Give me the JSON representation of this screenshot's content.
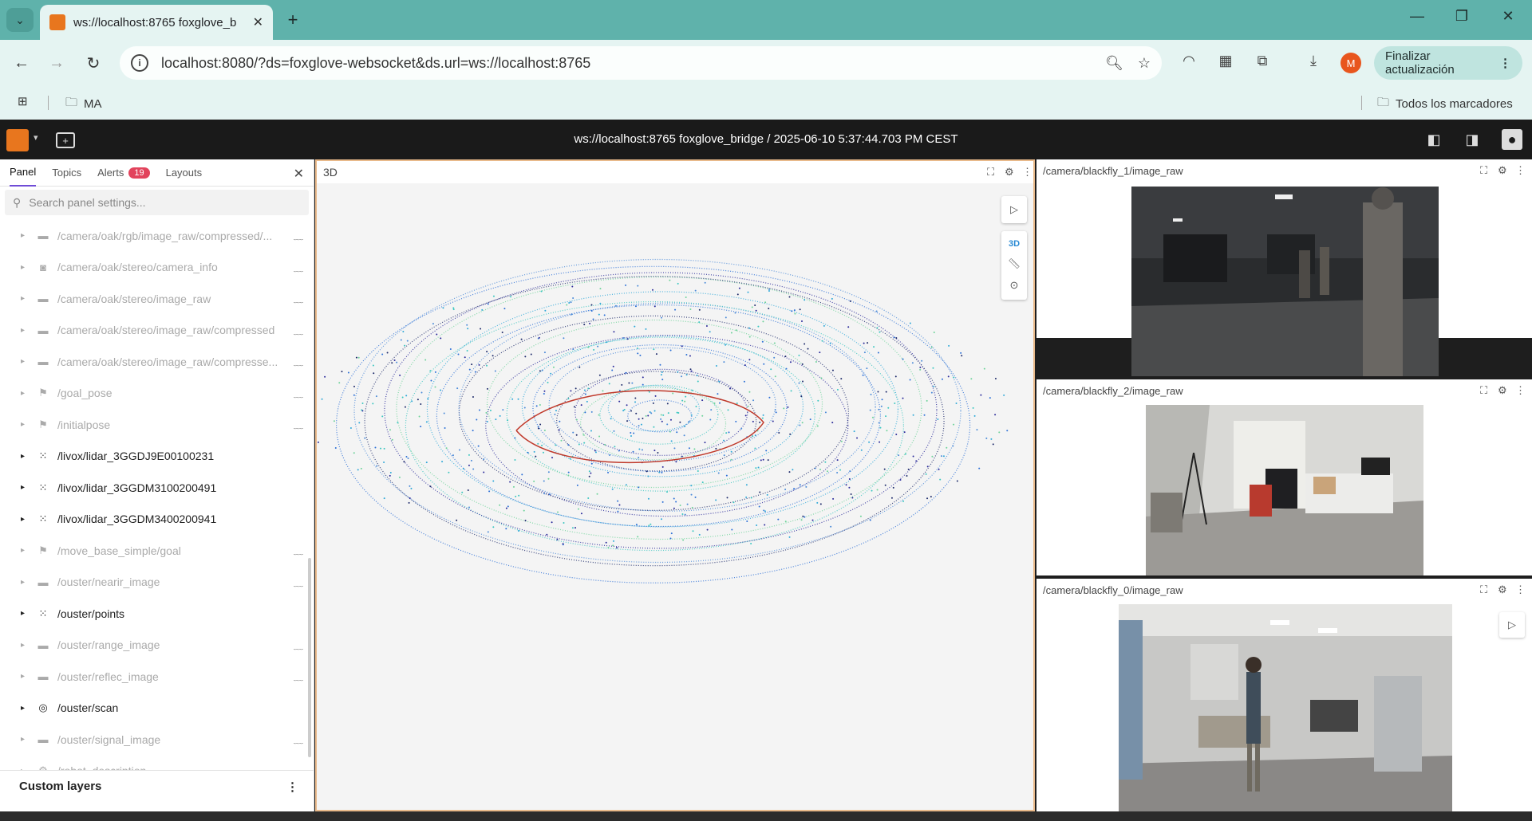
{
  "browser": {
    "tab_title": "ws://localhost:8765 foxglove_b",
    "url": "localhost:8080/?ds=foxglove-websocket&ds.url=ws://localhost:8765",
    "profile_initial": "M",
    "update_label": "Finalizar actualización",
    "bookmark_folder": "MA",
    "all_bookmarks": "Todos los marcadores"
  },
  "app": {
    "title": "ws://localhost:8765 foxglove_bridge / 2025-06-10 5:37:44.703 PM CEST"
  },
  "sidebar": {
    "tabs": [
      "Panel",
      "Topics",
      "Alerts",
      "Layouts"
    ],
    "alerts_count": "19",
    "search_placeholder": "Search panel settings...",
    "items": [
      {
        "label": "/camera/oak/rgb/image_raw/compressed/...",
        "icon": "image-icon",
        "dim": true
      },
      {
        "label": "/camera/oak/stereo/camera_info",
        "icon": "camera-icon",
        "dim": true
      },
      {
        "label": "/camera/oak/stereo/image_raw",
        "icon": "image-icon",
        "dim": true
      },
      {
        "label": "/camera/oak/stereo/image_raw/compressed",
        "icon": "image-icon",
        "dim": true
      },
      {
        "label": "/camera/oak/stereo/image_raw/compresse...",
        "icon": "image-icon",
        "dim": true
      },
      {
        "label": "/goal_pose",
        "icon": "flag-icon",
        "dim": true
      },
      {
        "label": "/initialpose",
        "icon": "flag-icon",
        "dim": true
      },
      {
        "label": "/livox/lidar_3GGDJ9E00100231",
        "icon": "points-icon",
        "dim": false
      },
      {
        "label": "/livox/lidar_3GGDM3100200491",
        "icon": "points-icon",
        "dim": false
      },
      {
        "label": "/livox/lidar_3GGDM3400200941",
        "icon": "points-icon",
        "dim": false
      },
      {
        "label": "/move_base_simple/goal",
        "icon": "flag-icon",
        "dim": true
      },
      {
        "label": "/ouster/nearir_image",
        "icon": "image-icon",
        "dim": true
      },
      {
        "label": "/ouster/points",
        "icon": "points-icon",
        "dim": false
      },
      {
        "label": "/ouster/range_image",
        "icon": "image-icon",
        "dim": true
      },
      {
        "label": "/ouster/reflec_image",
        "icon": "image-icon",
        "dim": true
      },
      {
        "label": "/ouster/scan",
        "icon": "scan-icon",
        "dim": false
      },
      {
        "label": "/ouster/signal_image",
        "icon": "image-icon",
        "dim": true
      },
      {
        "label": "/robot_description",
        "icon": "robot-icon",
        "dim": true
      }
    ],
    "custom_layers": "Custom layers"
  },
  "panel3d": {
    "title": "3D",
    "mode_label": "3D"
  },
  "cameras": [
    {
      "title": "/camera/blackfly_1/image_raw"
    },
    {
      "title": "/camera/blackfly_2/image_raw"
    },
    {
      "title": "/camera/blackfly_0/image_raw"
    }
  ]
}
